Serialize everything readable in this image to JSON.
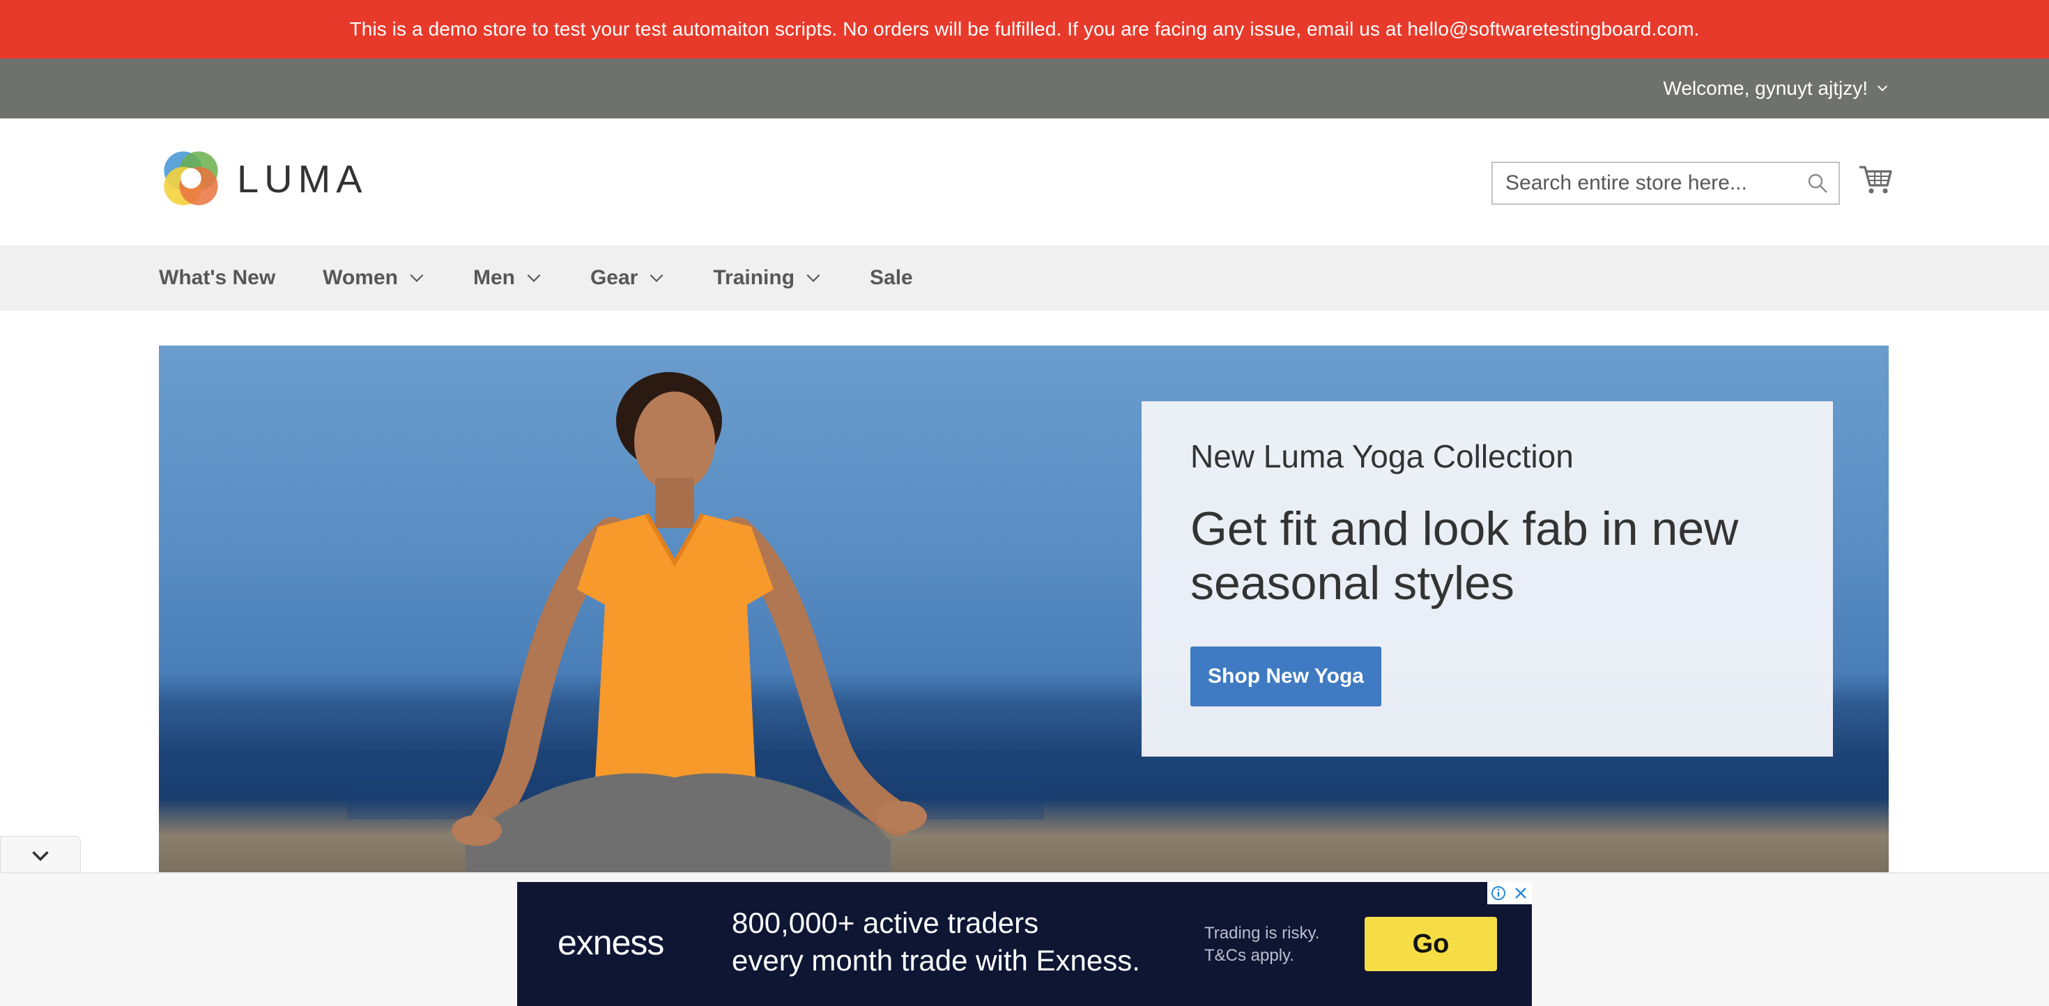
{
  "notice": {
    "text": "This is a demo store to test your test automaiton scripts. No orders will be fulfilled. If you are facing any issue, email us at hello@softwaretestingboard.com."
  },
  "account": {
    "welcome": "Welcome, gynuyt ajtjzy!"
  },
  "header": {
    "logo_text": "LUMA",
    "search_placeholder": "Search entire store here..."
  },
  "nav": {
    "items": [
      {
        "label": "What's New"
      },
      {
        "label": "Women"
      },
      {
        "label": "Men"
      },
      {
        "label": "Gear"
      },
      {
        "label": "Training"
      },
      {
        "label": "Sale"
      }
    ]
  },
  "hero": {
    "subtitle": "New Luma Yoga Collection",
    "title": "Get fit and look fab in new seasonal styles",
    "button": "Shop New Yoga"
  },
  "ad": {
    "brand": "exness",
    "headline_line1": "800,000+ active traders",
    "headline_line2": "every month trade with Exness.",
    "disclaimer_line1": "Trading is risky.",
    "disclaimer_line2": "T&Cs apply.",
    "cta": "Go"
  },
  "colors": {
    "notice_bg": "#e83a2b",
    "welcome_bg": "#6e716e",
    "nav_bg": "#f0f0f0",
    "button_blue": "#3f7ac2",
    "ad_bg": "#0e1634",
    "ad_cta": "#f6dd45"
  },
  "icons": {
    "logo": "luma-logo-icon",
    "search": "search-icon",
    "cart": "cart-icon",
    "chevron": "chevron-down-icon",
    "ad_info": "info-icon",
    "ad_close": "close-icon"
  }
}
